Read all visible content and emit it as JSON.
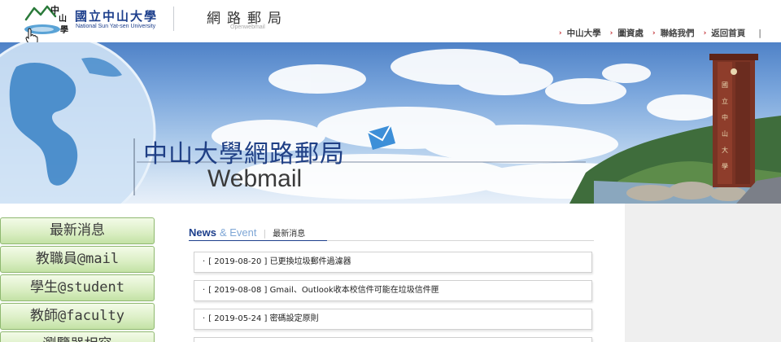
{
  "header": {
    "university_name": "國立中山大學",
    "university_name_en": "National Sun Yat-sen University",
    "site_title": "網路郵局",
    "site_subtitle": "Openwebmail",
    "nav_links": [
      {
        "label": "中山大學"
      },
      {
        "label": "圖資處"
      },
      {
        "label": "聯絡我們"
      },
      {
        "label": "返回首頁"
      }
    ],
    "separator": "|"
  },
  "banner": {
    "title": "中山大學網路郵局",
    "subtitle": "Webmail"
  },
  "sidebar": {
    "items": [
      {
        "label": "最新消息"
      },
      {
        "label": "教職員@mail"
      },
      {
        "label": "學生@student"
      },
      {
        "label": "教師@faculty"
      },
      {
        "label": "瀏覽器相容"
      }
    ]
  },
  "news": {
    "heading_en_1": "News",
    "heading_en_2": "& Event",
    "heading_sep": "|",
    "heading_zh": "最新消息",
    "bullet": "·",
    "items": [
      {
        "text": "[ 2019-08-20 ] 已更換垃圾郵件過濾器"
      },
      {
        "text": "[ 2019-08-08 ] Gmail、Outlook收本校信件可能在垃圾信件匣"
      },
      {
        "text": "[ 2019-05-24 ] 密碼設定原則"
      },
      {
        "text": ""
      }
    ]
  },
  "colors": {
    "brand_blue": "#1d3f8c",
    "arrow_red": "#c0282d",
    "menu_green": "#c3e2a5"
  }
}
